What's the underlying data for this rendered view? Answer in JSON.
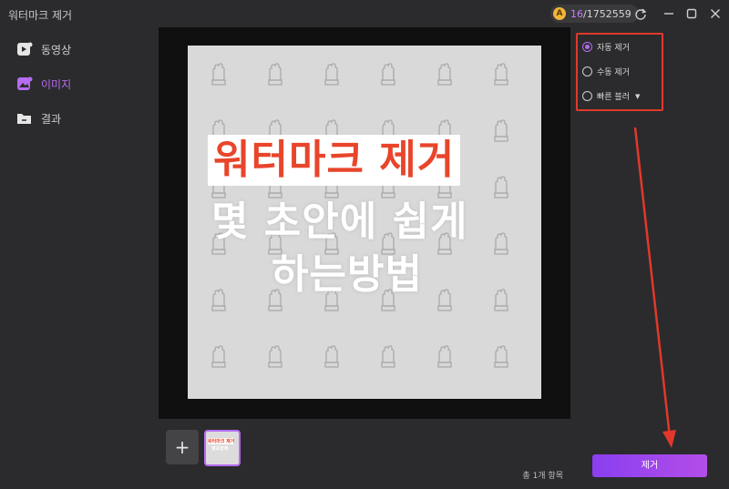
{
  "app": {
    "title": "워터마크 제거"
  },
  "credits": {
    "used": "16",
    "total": "/1752559"
  },
  "sidebar": {
    "items": [
      {
        "label": "동영상",
        "icon": "video-icon",
        "active": false
      },
      {
        "label": "이미지",
        "icon": "image-icon",
        "active": true
      },
      {
        "label": "결과",
        "icon": "folder-icon",
        "active": false
      }
    ]
  },
  "preview": {
    "image_text": {
      "line1": "워터마크 제거",
      "line2": "몇 초안에 쉽게",
      "line3": "하는방법"
    }
  },
  "thumbnail": {
    "line1": "워터마크 제거",
    "line2": "몇초안에"
  },
  "footer": {
    "count_text": "총 1개 항목"
  },
  "options": [
    {
      "label": "자동 제거",
      "selected": true
    },
    {
      "label": "수동 제거",
      "selected": false
    },
    {
      "label": "빠른 블러",
      "selected": false,
      "has_dropdown": true
    }
  ],
  "actions": {
    "remove_label": "제거"
  },
  "colors": {
    "accent": "#b56cf0",
    "highlight": "#e0392b",
    "button_gradient_start": "#8a3ff0"
  }
}
